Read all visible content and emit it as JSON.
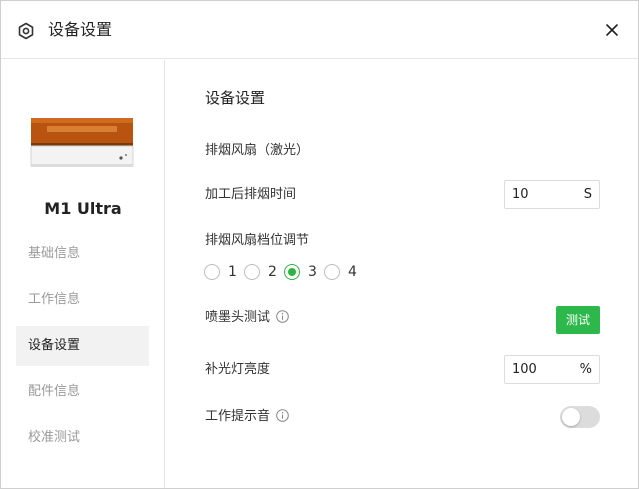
{
  "window": {
    "title": "设备设置",
    "title_icon": "settings-hexagon-icon",
    "close_icon": "close-icon"
  },
  "sidebar": {
    "device_name": "M1 Ultra",
    "items": [
      {
        "label": "基础信息",
        "active": false
      },
      {
        "label": "工作信息",
        "active": false
      },
      {
        "label": "设备设置",
        "active": true
      },
      {
        "label": "配件信息",
        "active": false
      },
      {
        "label": "校准测试",
        "active": false
      }
    ]
  },
  "main": {
    "section_title": "设备设置",
    "fan_label": "排烟风扇（激光）",
    "post_exhaust": {
      "label": "加工后排烟时间",
      "value": "10",
      "unit": "S"
    },
    "fan_level": {
      "label": "排烟风扇档位调节",
      "options": [
        "1",
        "2",
        "3",
        "4"
      ],
      "selected": "3"
    },
    "nozzle_test": {
      "label": "喷墨头测试",
      "button_label": "测试",
      "info_icon": "info-icon"
    },
    "fill_light": {
      "label": "补光灯亮度",
      "value": "100",
      "unit": "%"
    },
    "work_sound": {
      "label": "工作提示音",
      "enabled": false,
      "info_icon": "info-icon"
    }
  },
  "colors": {
    "accent": "#2db84c",
    "active_nav_bg": "#f2f2f2",
    "toggle_off": "#dcdcdc"
  }
}
